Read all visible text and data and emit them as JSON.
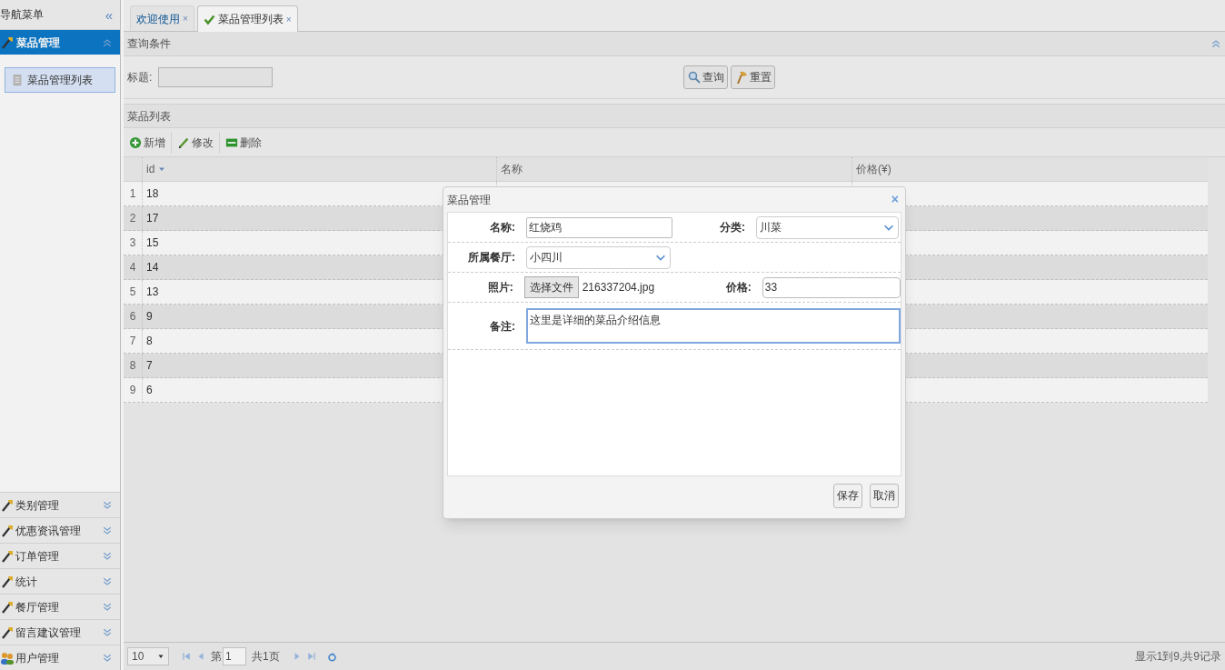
{
  "sidebar": {
    "title": "导航菜单",
    "collapse": "«",
    "active_group": {
      "label": "菜品管理",
      "expanded": true,
      "items": [
        {
          "label": "菜品管理列表",
          "selected": true
        }
      ]
    },
    "groups": [
      {
        "label": "类别管理",
        "kind": "wrench",
        "expanded": false
      },
      {
        "label": "优惠资讯管理",
        "kind": "wrench",
        "expanded": false
      },
      {
        "label": "订单管理",
        "kind": "wrench",
        "expanded": false
      },
      {
        "label": "统计",
        "kind": "wrench",
        "expanded": false
      },
      {
        "label": "餐厅管理",
        "kind": "wrench",
        "expanded": false
      },
      {
        "label": "留言建议管理",
        "kind": "wrench",
        "expanded": false
      },
      {
        "label": "用户管理",
        "kind": "users",
        "expanded": false
      }
    ]
  },
  "tabs": [
    {
      "label": "欢迎使用",
      "selected": false,
      "icon": false,
      "close": "×"
    },
    {
      "label": "菜品管理列表",
      "selected": true,
      "icon": true,
      "close": "×"
    }
  ],
  "query": {
    "title": "查询条件",
    "field_label": "标题:",
    "buttons": [
      {
        "label": "查询",
        "kind": "search"
      },
      {
        "label": "重置",
        "kind": "reset"
      }
    ]
  },
  "list": {
    "title": "菜品列表",
    "toolbar": [
      {
        "label": "新增",
        "kind": "add"
      },
      {
        "label": "修改",
        "kind": "edit"
      },
      {
        "label": "删除",
        "kind": "delete"
      }
    ],
    "columns": [
      "id",
      "名称",
      "价格(¥)"
    ],
    "rows": [
      {
        "num": "1",
        "id": "18"
      },
      {
        "num": "2",
        "id": "17"
      },
      {
        "num": "3",
        "id": "15"
      },
      {
        "num": "4",
        "id": "14"
      },
      {
        "num": "5",
        "id": "13"
      },
      {
        "num": "6",
        "id": "9"
      },
      {
        "num": "7",
        "id": "8"
      },
      {
        "num": "8",
        "id": "7"
      },
      {
        "num": "9",
        "id": "6"
      }
    ]
  },
  "pager": {
    "page_size": "10",
    "page_prefix": "第",
    "page": "1",
    "page_total": "共1页",
    "summary": "显示1到9,共9记录"
  },
  "dialog": {
    "title": "菜品管理",
    "close": "×",
    "name_label": "名称:",
    "name": "红烧鸡",
    "category_label": "分类:",
    "category": "川菜",
    "restaurant_label": "所属餐厅:",
    "restaurant": "小四川",
    "photo_label": "照片:",
    "file_button": "选择文件",
    "file_name": "216337204.jpg",
    "price_label": "价格:",
    "price": "33",
    "note_label": "备注:",
    "note": "这里是详细的菜品介绍信息",
    "buttons": [
      "保存",
      "取消"
    ]
  }
}
